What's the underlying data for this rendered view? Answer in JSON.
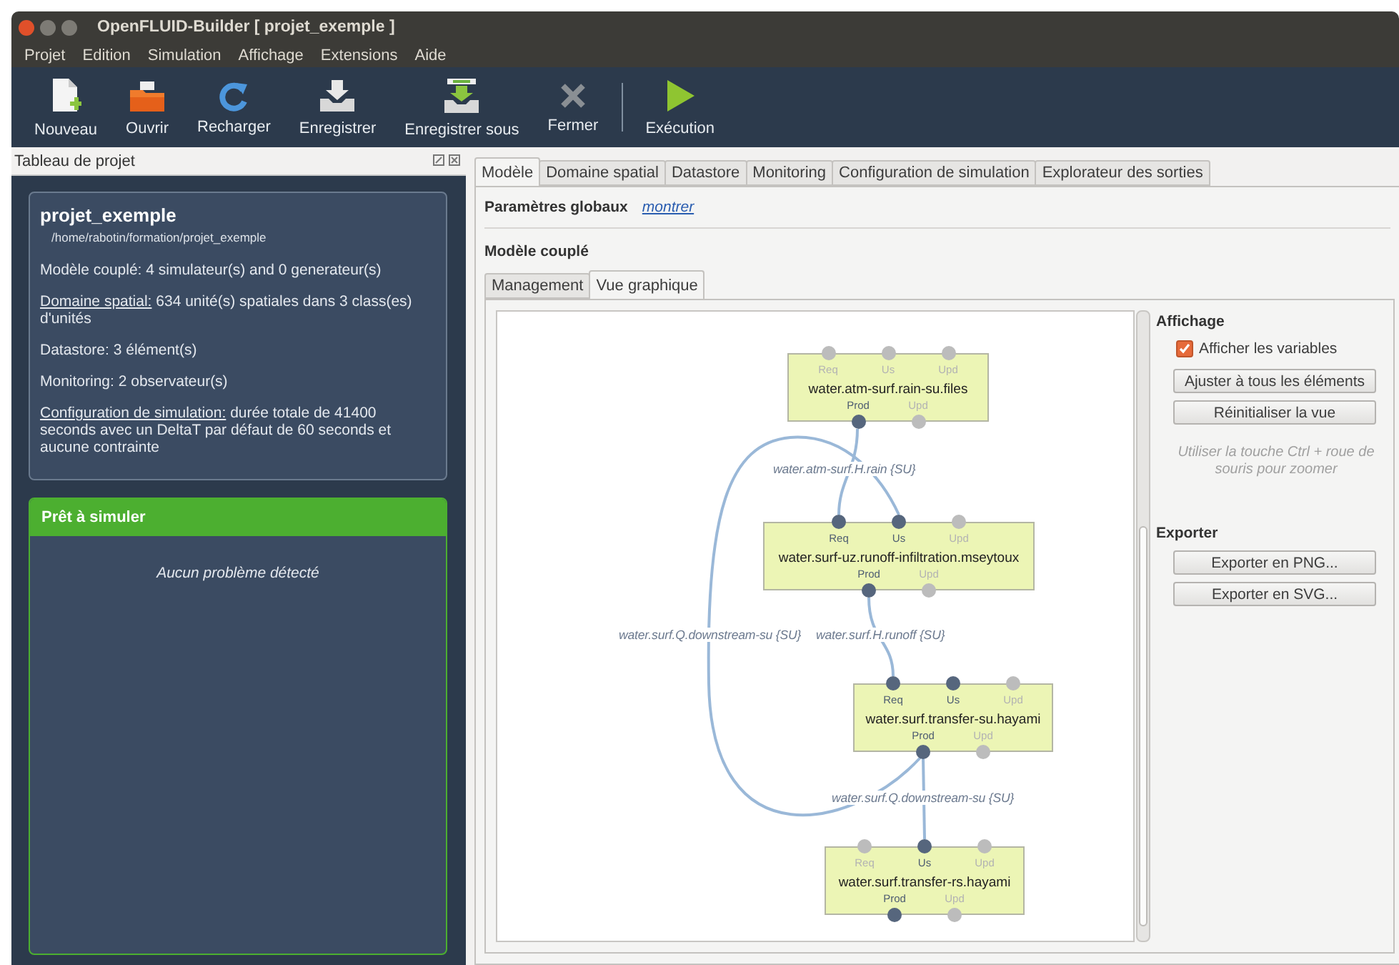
{
  "window": {
    "title": "OpenFLUID-Builder [ projet_exemple ]"
  },
  "menu": [
    "Projet",
    "Edition",
    "Simulation",
    "Affichage",
    "Extensions",
    "Aide"
  ],
  "toolbar": [
    {
      "kind": "new",
      "label": "Nouveau"
    },
    {
      "kind": "open",
      "label": "Ouvrir"
    },
    {
      "kind": "reload",
      "label": "Recharger"
    },
    {
      "kind": "save",
      "label": "Enregistrer"
    },
    {
      "kind": "saveas",
      "label": "Enregistrer sous"
    },
    {
      "kind": "close",
      "label": "Fermer"
    },
    {
      "kind": "separator"
    },
    {
      "kind": "run",
      "label": "Exécution"
    }
  ],
  "project_panel": {
    "title": "Tableau de projet",
    "project": {
      "name": "projet_exemple",
      "path": "/home/rabotin/formation/projet_exemple",
      "items": [
        {
          "kind": "plain",
          "text": "Modèle couplé: 4 simulateur(s) and 0 generateur(s)"
        },
        {
          "kind": "link",
          "link": "Domaine spatial:",
          "text": " 634 unité(s) spatiales dans 3 class(es) d'unités"
        },
        {
          "kind": "plain",
          "text": "Datastore: 3 élément(s)"
        },
        {
          "kind": "plain",
          "text": "Monitoring: 2 observateur(s)"
        },
        {
          "kind": "link",
          "link": "Configuration de simulation:",
          "text": " durée totale de 41400 seconds avec un DeltaT par défaut de 60 seconds et aucune contrainte"
        }
      ]
    },
    "status": {
      "title": "Prêt à simuler",
      "message": "Aucun problème détecté"
    }
  },
  "tabs": [
    {
      "label": "Modèle",
      "selected": true
    },
    {
      "label": "Domaine spatial",
      "selected": false
    },
    {
      "label": "Datastore",
      "selected": false
    },
    {
      "label": "Monitoring",
      "selected": false
    },
    {
      "label": "Configuration de simulation",
      "selected": false
    },
    {
      "label": "Explorateur des sorties",
      "selected": false
    }
  ],
  "global_params": {
    "label": "Paramètres globaux",
    "link": "montrer"
  },
  "coupled_model": {
    "title": "Modèle couplé",
    "tabs": [
      {
        "label": "Management",
        "selected": false
      },
      {
        "label": "Vue graphique",
        "selected": true
      }
    ],
    "graph": {
      "nodes": [
        {
          "name": "water.atm-surf.rain-su.files",
          "top_ports": [
            {
              "label": "Req",
              "active": false
            },
            {
              "label": "Us",
              "active": false
            },
            {
              "label": "Upd",
              "active": false
            }
          ],
          "bottom_ports": [
            {
              "label": "Prod",
              "active": true
            },
            {
              "label": "Upd",
              "active": false
            }
          ]
        },
        {
          "name": "water.surf-uz.runoff-infiltration.mseytoux",
          "top_ports": [
            {
              "label": "Req",
              "active": true
            },
            {
              "label": "Us",
              "active": true
            },
            {
              "label": "Upd",
              "active": false
            }
          ],
          "bottom_ports": [
            {
              "label": "Prod",
              "active": true
            },
            {
              "label": "Upd",
              "active": false
            }
          ]
        },
        {
          "name": "water.surf.transfer-su.hayami",
          "top_ports": [
            {
              "label": "Req",
              "active": true
            },
            {
              "label": "Us",
              "active": true
            },
            {
              "label": "Upd",
              "active": false
            }
          ],
          "bottom_ports": [
            {
              "label": "Prod",
              "active": true
            },
            {
              "label": "Upd",
              "active": false
            }
          ]
        },
        {
          "name": "water.surf.transfer-rs.hayami",
          "top_ports": [
            {
              "label": "Req",
              "active": false
            },
            {
              "label": "Us",
              "active": true
            },
            {
              "label": "Upd",
              "active": false
            }
          ],
          "bottom_ports": [
            {
              "label": "Prod",
              "active": true
            },
            {
              "label": "Upd",
              "active": false
            }
          ]
        }
      ],
      "edge_labels": [
        "water.atm-surf.H.rain {SU}",
        "water.surf.Q.downstream-su {SU}",
        "water.surf.H.runoff {SU}",
        "water.surf.Q.downstream-su {SU}"
      ]
    },
    "display": {
      "title": "Affichage",
      "show_variables": {
        "label": "Afficher les variables",
        "checked": true
      },
      "buttons": [
        "Ajuster à tous les éléments",
        "Réinitialiser la vue"
      ],
      "hint": "Utiliser la touche Ctrl + roue de souris pour zoomer"
    },
    "export": {
      "title": "Exporter",
      "buttons": [
        "Exporter en PNG...",
        "Exporter en SVG..."
      ]
    }
  }
}
